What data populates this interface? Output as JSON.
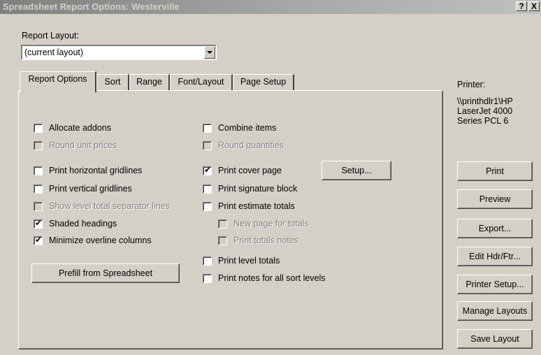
{
  "window": {
    "title": "Spreadsheet Report Options: Westerville",
    "help_glyph": "?",
    "close_glyph": "X"
  },
  "report_layout": {
    "label": "Report Layout:",
    "value": "(current layout)"
  },
  "tabs": [
    "Report Options",
    "Sort",
    "Range",
    "Font/Layout",
    "Page Setup"
  ],
  "left_options": [
    {
      "label": "Allocate addons",
      "checked": false,
      "enabled": true
    },
    {
      "label": "Round unit prices",
      "checked": false,
      "enabled": false
    },
    {
      "label": "Print horizontal gridlines",
      "checked": false,
      "enabled": true
    },
    {
      "label": "Print vertical gridlines",
      "checked": false,
      "enabled": true
    },
    {
      "label": "Show level total separator lines",
      "checked": false,
      "enabled": false
    },
    {
      "label": "Shaded headings",
      "checked": true,
      "enabled": true
    },
    {
      "label": "Minimize overline columns",
      "checked": true,
      "enabled": true
    }
  ],
  "right_options": [
    {
      "label": "Combine items",
      "checked": false,
      "enabled": true
    },
    {
      "label": "Round quantities",
      "checked": false,
      "enabled": false
    },
    {
      "label": "Print cover page",
      "checked": true,
      "enabled": true
    },
    {
      "label": "Print signature block",
      "checked": false,
      "enabled": true
    },
    {
      "label": "Print estimate totals",
      "checked": false,
      "enabled": true
    },
    {
      "label": "New page for totals",
      "checked": false,
      "enabled": false
    },
    {
      "label": "Print totals notes",
      "checked": false,
      "enabled": false
    },
    {
      "label": "Print level totals",
      "checked": false,
      "enabled": true
    },
    {
      "label": "Print notes for all sort levels",
      "checked": false,
      "enabled": true
    }
  ],
  "setup_button": "Setup...",
  "prefill_button": "Prefill from Spreadsheet",
  "printer": {
    "label": "Printer:",
    "line1": "\\\\printhdlr1\\HP",
    "line2": "LaserJet 4000",
    "line3": "Series PCL 6"
  },
  "side_buttons": [
    "Print",
    "Preview",
    "Export...",
    "Edit Hdr/Ftr...",
    "Printer Setup...",
    "Manage Layouts",
    "Save Layout"
  ]
}
